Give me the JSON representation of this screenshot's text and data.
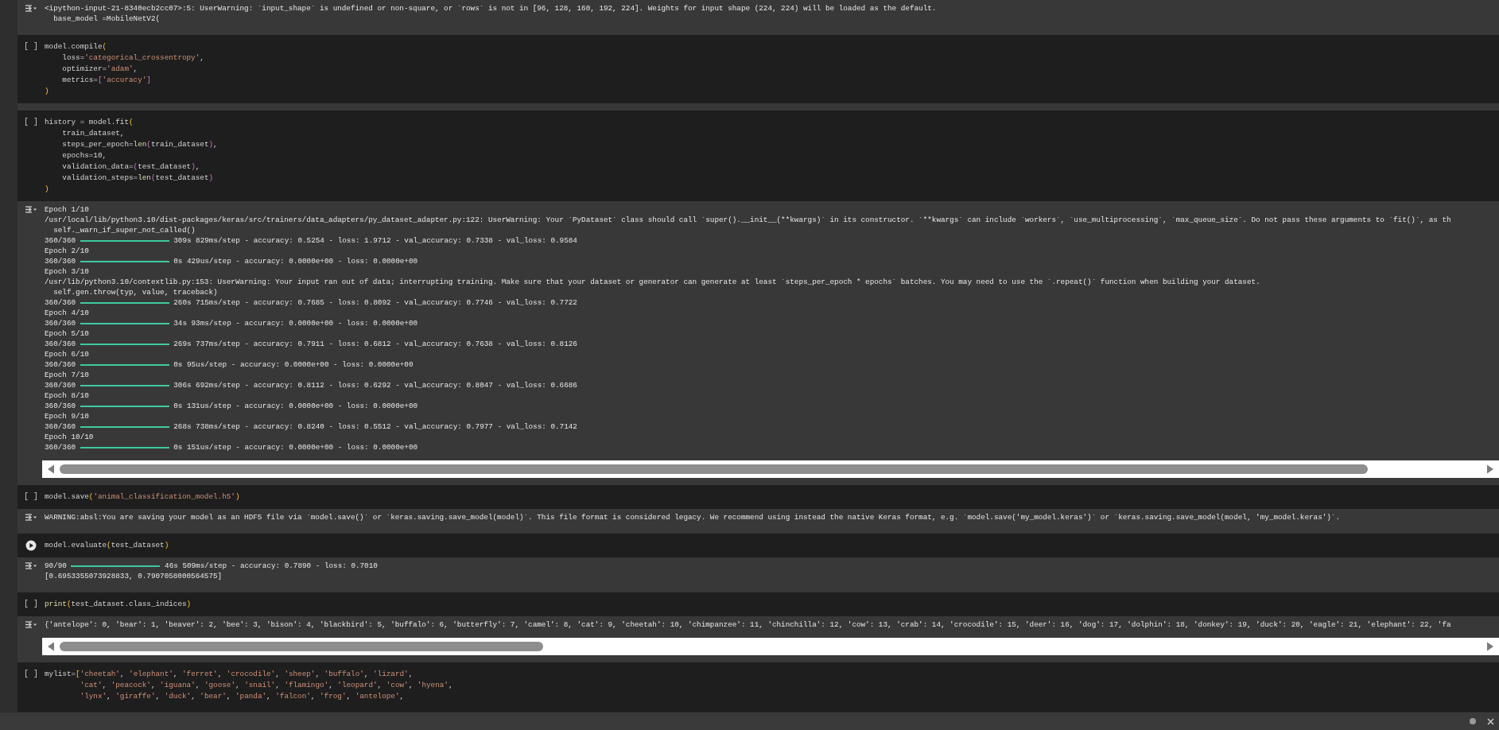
{
  "cells": [
    {
      "kind": "output",
      "scrollbar": false,
      "lines": [
        {
          "kind": "text",
          "text": "<ipython-input-21-8340ecb2cc07>:5: UserWarning: `input_shape` is undefined or non-square, or `rows` is not in [96, 128, 160, 192, 224]. Weights for input shape (224, 224) will be loaded as the default."
        },
        {
          "kind": "text",
          "text": "  base_model =MobileNetV2("
        }
      ]
    },
    {
      "kind": "code",
      "run_control": {
        "kind": "brackets",
        "text": "[ ]"
      },
      "lines": [
        [
          {
            "text": "model.compile",
            "kind": "plain"
          },
          {
            "text": "(",
            "kind": "bracket1"
          }
        ],
        [
          {
            "text": "    loss=",
            "kind": "plain"
          },
          {
            "text": "'categorical_crossentropy'",
            "kind": "string"
          },
          {
            "text": ",",
            "kind": "plain"
          }
        ],
        [
          {
            "text": "    optimizer=",
            "kind": "plain"
          },
          {
            "text": "'adam'",
            "kind": "string"
          },
          {
            "text": ",",
            "kind": "plain"
          }
        ],
        [
          {
            "text": "    metrics=",
            "kind": "plain"
          },
          {
            "text": "[",
            "kind": "bracket2"
          },
          {
            "text": "'accuracy'",
            "kind": "string"
          },
          {
            "text": "]",
            "kind": "bracket2"
          }
        ],
        [
          {
            "text": ")",
            "kind": "bracket1"
          }
        ]
      ]
    },
    {
      "kind": "code",
      "run_control": {
        "kind": "brackets",
        "text": "[ ]"
      },
      "lines": [
        [
          {
            "text": "history = model.fit",
            "kind": "plain"
          },
          {
            "text": "(",
            "kind": "bracket1"
          }
        ],
        [
          {
            "text": "    train_dataset,",
            "kind": "plain"
          }
        ],
        [
          {
            "text": "    steps_per_epoch=",
            "kind": "plain"
          },
          {
            "text": "len",
            "kind": "function"
          },
          {
            "text": "(",
            "kind": "bracket2"
          },
          {
            "text": "train_dataset",
            "kind": "plain"
          },
          {
            "text": ")",
            "kind": "bracket2"
          },
          {
            "text": ",",
            "kind": "plain"
          }
        ],
        [
          {
            "text": "    epochs=10,",
            "kind": "plain"
          }
        ],
        [
          {
            "text": "    validation_data=",
            "kind": "plain"
          },
          {
            "text": "(",
            "kind": "bracket2"
          },
          {
            "text": "test_dataset",
            "kind": "plain"
          },
          {
            "text": ")",
            "kind": "bracket2"
          },
          {
            "text": ",",
            "kind": "plain"
          }
        ],
        [
          {
            "text": "    validation_steps=",
            "kind": "plain"
          },
          {
            "text": "len",
            "kind": "function"
          },
          {
            "text": "(",
            "kind": "bracket2"
          },
          {
            "text": "test_dataset",
            "kind": "plain"
          },
          {
            "text": ")",
            "kind": "bracket2"
          }
        ],
        [
          {
            "text": ")",
            "kind": "bracket1"
          }
        ]
      ]
    },
    {
      "kind": "output",
      "scrollbar": true,
      "lines": [
        {
          "kind": "text",
          "text": "Epoch 1/10"
        },
        {
          "kind": "text",
          "text": "/usr/local/lib/python3.10/dist-packages/keras/src/trainers/data_adapters/py_dataset_adapter.py:122: UserWarning: Your `PyDataset` class should call `super().__init__(**kwargs)` in its constructor. `**kwargs` can include `workers`, `use_multiprocessing`, `max_queue_size`. Do not pass these arguments to `fit()`, as th"
        },
        {
          "kind": "text",
          "text": "  self._warn_if_super_not_called()"
        },
        {
          "kind": "progress",
          "count": "360/360",
          "level": 1,
          "stats": "309s 829ms/step - accuracy: 0.5254 - loss: 1.9712 - val_accuracy: 0.7338 - val_loss: 0.9584"
        },
        {
          "kind": "text",
          "text": "Epoch 2/10"
        },
        {
          "kind": "progress",
          "count": "360/360",
          "level": 1,
          "stats": "0s 429us/step - accuracy: 0.0000e+00 - loss: 0.0000e+00"
        },
        {
          "kind": "text",
          "text": "Epoch 3/10"
        },
        {
          "kind": "text",
          "text": "/usr/lib/python3.10/contextlib.py:153: UserWarning: Your input ran out of data; interrupting training. Make sure that your dataset or generator can generate at least `steps_per_epoch * epochs` batches. You may need to use the `.repeat()` function when building your dataset."
        },
        {
          "kind": "text",
          "text": "  self.gen.throw(typ, value, traceback)"
        },
        {
          "kind": "progress",
          "count": "360/360",
          "level": 1,
          "stats": "260s 715ms/step - accuracy: 0.7685 - loss: 0.8092 - val_accuracy: 0.7746 - val_loss: 0.7722"
        },
        {
          "kind": "text",
          "text": "Epoch 4/10"
        },
        {
          "kind": "progress",
          "count": "360/360",
          "level": 1,
          "stats": "34s 93ms/step - accuracy: 0.0000e+00 - loss: 0.0000e+00"
        },
        {
          "kind": "text",
          "text": "Epoch 5/10"
        },
        {
          "kind": "progress",
          "count": "360/360",
          "level": 1,
          "stats": "269s 737ms/step - accuracy: 0.7911 - loss: 0.6812 - val_accuracy: 0.7638 - val_loss: 0.8126"
        },
        {
          "kind": "text",
          "text": "Epoch 6/10"
        },
        {
          "kind": "progress",
          "count": "360/360",
          "level": 1,
          "stats": "0s 95us/step - accuracy: 0.0000e+00 - loss: 0.0000e+00"
        },
        {
          "kind": "text",
          "text": "Epoch 7/10"
        },
        {
          "kind": "progress",
          "count": "360/360",
          "level": 1,
          "stats": "306s 692ms/step - accuracy: 0.8112 - loss: 0.6292 - val_accuracy: 0.8047 - val_loss: 0.6686"
        },
        {
          "kind": "text",
          "text": "Epoch 8/10"
        },
        {
          "kind": "progress",
          "count": "360/360",
          "level": 1,
          "stats": "0s 131us/step - accuracy: 0.0000e+00 - loss: 0.0000e+00"
        },
        {
          "kind": "text",
          "text": "Epoch 9/10"
        },
        {
          "kind": "progress",
          "count": "360/360",
          "level": 1,
          "stats": "268s 738ms/step - accuracy: 0.8240 - loss: 0.5512 - val_accuracy: 0.7977 - val_loss: 0.7142"
        },
        {
          "kind": "text",
          "text": "Epoch 10/10"
        },
        {
          "kind": "progress",
          "count": "360/360",
          "level": 1,
          "stats": "0s 151us/step - accuracy: 0.0000e+00 - loss: 0.0000e+00"
        }
      ]
    },
    {
      "kind": "code",
      "run_control": {
        "kind": "brackets",
        "text": "[ ]"
      },
      "lines": [
        [
          {
            "text": "model.save",
            "kind": "plain"
          },
          {
            "text": "(",
            "kind": "bracket1"
          },
          {
            "text": "'animal_classification_model.h5'",
            "kind": "string"
          },
          {
            "text": ")",
            "kind": "bracket1"
          }
        ]
      ]
    },
    {
      "kind": "output",
      "scrollbar": false,
      "lines": [
        {
          "kind": "text",
          "text": "WARNING:absl:You are saving your model as an HDF5 file via `model.save()` or `keras.saving.save_model(model)`. This file format is considered legacy. We recommend using instead the native Keras format, e.g. `model.save('my_model.keras')` or `keras.saving.save_model(model, 'my_model.keras')`."
        }
      ]
    },
    {
      "kind": "code",
      "run_control": {
        "kind": "play"
      },
      "lines": [
        [
          {
            "text": "model.evaluate",
            "kind": "plain"
          },
          {
            "text": "(",
            "kind": "bracket1"
          },
          {
            "text": "test_dataset",
            "kind": "plain"
          },
          {
            "text": ")",
            "kind": "bracket1"
          }
        ]
      ]
    },
    {
      "kind": "output",
      "scrollbar": false,
      "lines": [
        {
          "kind": "progress",
          "count": "90/90",
          "level": 1,
          "stats": "46s 509ms/step - accuracy: 0.7890 - loss: 0.7010"
        },
        {
          "kind": "text",
          "text": "[0.6953355073928833, 0.7907058000564575]"
        }
      ]
    },
    {
      "kind": "code",
      "run_control": {
        "kind": "brackets",
        "text": "[ ]"
      },
      "lines": [
        [
          {
            "text": "print",
            "kind": "function"
          },
          {
            "text": "(",
            "kind": "bracket1"
          },
          {
            "text": "test_dataset.class_indices",
            "kind": "plain"
          },
          {
            "text": ")",
            "kind": "bracket1"
          }
        ]
      ]
    },
    {
      "kind": "output",
      "scrollbar": true,
      "lines": [
        {
          "kind": "text",
          "text": "{'antelope': 0, 'bear': 1, 'beaver': 2, 'bee': 3, 'bison': 4, 'blackbird': 5, 'buffalo': 6, 'butterfly': 7, 'camel': 8, 'cat': 9, 'cheetah': 10, 'chimpanzee': 11, 'chinchilla': 12, 'cow': 13, 'crab': 14, 'crocodile': 15, 'deer': 16, 'dog': 17, 'dolphin': 18, 'donkey': 19, 'duck': 20, 'eagle': 21, 'elephant': 22, 'fa"
        }
      ]
    },
    {
      "kind": "code",
      "run_control": {
        "kind": "brackets",
        "text": "[ ]"
      },
      "lines": [
        [
          {
            "text": "mylist=",
            "kind": "plain"
          },
          {
            "text": "[",
            "kind": "bracket1"
          },
          {
            "text": "'cheetah'",
            "kind": "string"
          },
          {
            "text": ", ",
            "kind": "plain"
          },
          {
            "text": "'elephant'",
            "kind": "string"
          },
          {
            "text": ", ",
            "kind": "plain"
          },
          {
            "text": "'ferret'",
            "kind": "string"
          },
          {
            "text": ", ",
            "kind": "plain"
          },
          {
            "text": "'crocodile'",
            "kind": "string"
          },
          {
            "text": ", ",
            "kind": "plain"
          },
          {
            "text": "'sheep'",
            "kind": "string"
          },
          {
            "text": ", ",
            "kind": "plain"
          },
          {
            "text": "'buffalo'",
            "kind": "string"
          },
          {
            "text": ", ",
            "kind": "plain"
          },
          {
            "text": "'lizard'",
            "kind": "string"
          },
          {
            "text": ",",
            "kind": "plain"
          }
        ],
        [
          {
            "text": "        'cat'",
            "kind": "string"
          },
          {
            "text": ", ",
            "kind": "plain"
          },
          {
            "text": "'peacock'",
            "kind": "string"
          },
          {
            "text": ", ",
            "kind": "plain"
          },
          {
            "text": "'iguana'",
            "kind": "string"
          },
          {
            "text": ", ",
            "kind": "plain"
          },
          {
            "text": "'goose'",
            "kind": "string"
          },
          {
            "text": ", ",
            "kind": "plain"
          },
          {
            "text": "'snail'",
            "kind": "string"
          },
          {
            "text": ", ",
            "kind": "plain"
          },
          {
            "text": "'flamingo'",
            "kind": "string"
          },
          {
            "text": ", ",
            "kind": "plain"
          },
          {
            "text": "'leopard'",
            "kind": "string"
          },
          {
            "text": ", ",
            "kind": "plain"
          },
          {
            "text": "'cow'",
            "kind": "string"
          },
          {
            "text": ", ",
            "kind": "plain"
          },
          {
            "text": "'hyena'",
            "kind": "string"
          },
          {
            "text": ",",
            "kind": "plain"
          }
        ],
        [
          {
            "text": "        'lynx'",
            "kind": "string"
          },
          {
            "text": ", ",
            "kind": "plain"
          },
          {
            "text": "'giraffe'",
            "kind": "string"
          },
          {
            "text": ", ",
            "kind": "plain"
          },
          {
            "text": "'duck'",
            "kind": "string"
          },
          {
            "text": ", ",
            "kind": "plain"
          },
          {
            "text": "'bear'",
            "kind": "string"
          },
          {
            "text": ", ",
            "kind": "plain"
          },
          {
            "text": "'panda'",
            "kind": "string"
          },
          {
            "text": ", ",
            "kind": "plain"
          },
          {
            "text": "'falcon'",
            "kind": "string"
          },
          {
            "text": ", ",
            "kind": "plain"
          },
          {
            "text": "'frog'",
            "kind": "string"
          },
          {
            "text": ", ",
            "kind": "plain"
          },
          {
            "text": "'antelope'",
            "kind": "string"
          },
          {
            "text": ",",
            "kind": "plain"
          }
        ]
      ]
    }
  ]
}
